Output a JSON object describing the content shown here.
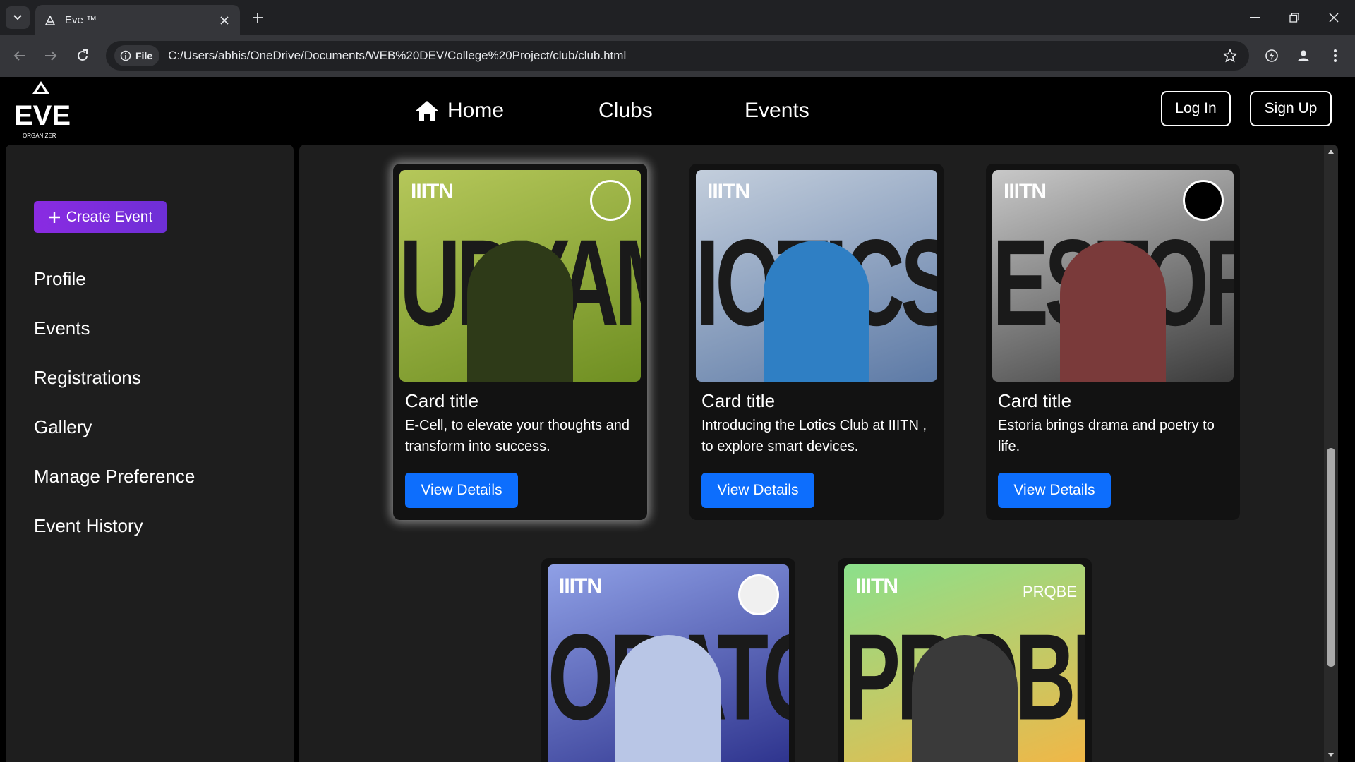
{
  "browser": {
    "tab_title": "Eve ™",
    "security_chip": "File",
    "url": "C:/Users/abhis/OneDrive/Documents/WEB%20DEV/College%20Project/club/club.html"
  },
  "header": {
    "logo_text": "EVE",
    "logo_subtext": "ORGANIZER",
    "nav": [
      {
        "label": "Home",
        "icon": "home-icon"
      },
      {
        "label": "Clubs"
      },
      {
        "label": "Events"
      }
    ],
    "login_label": "Log In",
    "signup_label": "Sign Up"
  },
  "sidebar": {
    "create_label": "Create Event",
    "items": [
      {
        "label": "Profile"
      },
      {
        "label": "Events"
      },
      {
        "label": "Registrations"
      },
      {
        "label": "Gallery"
      },
      {
        "label": "Manage Preference"
      },
      {
        "label": "Event History"
      }
    ]
  },
  "cards": [
    {
      "title": "Card title",
      "text": "E-Cell, to elevate your thoughts and transform into success.",
      "button": "View Details",
      "poster_word": "UDYAM",
      "poster_brand": "IIITN",
      "colors": [
        "#6f8f22",
        "#b5c75a"
      ]
    },
    {
      "title": "Card title",
      "text": "Introducing the Lotics Club at IIITN , to explore smart devices.",
      "button": "View Details",
      "poster_word": "IOTICS",
      "poster_brand": "IIITN",
      "colors": [
        "#5d7aa6",
        "#c3cedc"
      ]
    },
    {
      "title": "Card title",
      "text": "Estoria brings drama and poetry to life.",
      "button": "View Details",
      "poster_word": "ESTORIA",
      "poster_brand": "IIITN",
      "colors": [
        "#3b3b3b",
        "#c8c8c8"
      ]
    },
    {
      "poster_word": "ORATOR",
      "poster_brand": "IIITN",
      "colors": [
        "#2a2f8a",
        "#8fa0e6"
      ]
    },
    {
      "poster_word": "PROBE",
      "poster_brand": "IIITN",
      "poster_tag": "PRQBE",
      "colors": [
        "#f5b544",
        "#8be08b"
      ]
    }
  ],
  "accent": {
    "primary": "#0d6efd",
    "create": "#8a2be2"
  }
}
